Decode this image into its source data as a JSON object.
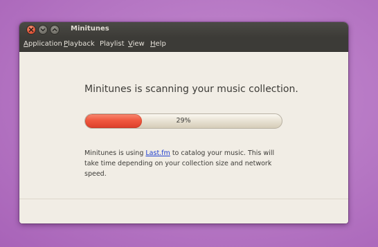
{
  "window": {
    "title": "Minitunes"
  },
  "menubar": {
    "items": [
      {
        "mnemonic": "A",
        "rest": "pplication"
      },
      {
        "mnemonic": "P",
        "rest": "layback"
      },
      {
        "mnemonic": "",
        "rest": "Playlist"
      },
      {
        "mnemonic": "V",
        "rest": "iew"
      },
      {
        "mnemonic": "H",
        "rest": "elp"
      }
    ]
  },
  "scan": {
    "heading": "Minitunes is scanning your music collection.",
    "progress_percent": 29,
    "progress_label": "29%",
    "desc_before": "Minitunes is using ",
    "desc_link": "Last.fm",
    "desc_after": " to catalog your music. This will take time depending on your collection size and network speed."
  },
  "colors": {
    "accent": "#f0583f",
    "link": "#1f3fd0",
    "titlebar": "#3c3b37",
    "desktop": "#b576c3"
  },
  "icons": {
    "close": "close-icon",
    "minimize": "minimize-icon",
    "maximize": "maximize-icon"
  }
}
